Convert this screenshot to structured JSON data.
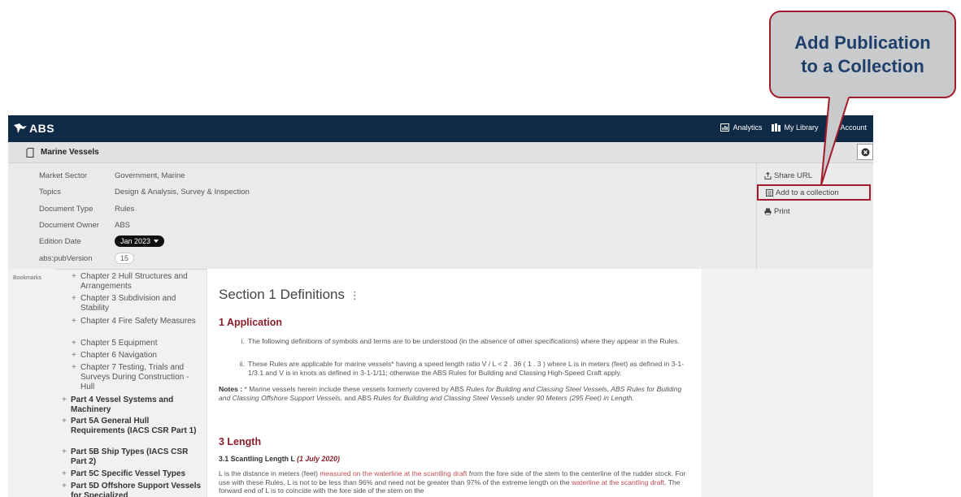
{
  "callout": {
    "text": "Add Publication\nto a Collection"
  },
  "header": {
    "logo": "ABS",
    "nav": [
      {
        "label": "Analytics",
        "icon": "bar-chart-icon"
      },
      {
        "label": "My Library",
        "icon": "library-icon"
      },
      {
        "label": "Account",
        "icon": "user-icon"
      }
    ]
  },
  "document": {
    "title": "Marine Vessels",
    "meta": [
      {
        "label": "Market Sector",
        "value": "Government, Marine"
      },
      {
        "label": "Topics",
        "value": "Design & Analysis, Survey & Inspection"
      },
      {
        "label": "Document Type",
        "value": "Rules"
      },
      {
        "label": "Document Owner",
        "value": "ABS"
      },
      {
        "label": "Edition Date",
        "value": "Jan 2023"
      },
      {
        "label": "abs:pubVersion",
        "value": "15"
      }
    ],
    "actions": [
      {
        "label": "Share URL",
        "icon": "share-icon"
      },
      {
        "label": "Add to a collection",
        "icon": "collection-icon"
      },
      {
        "label": "Print",
        "icon": "print-icon"
      }
    ]
  },
  "sidebar": {
    "rail_label": "Bookmarks",
    "toc": [
      "Chapter 2 Hull Structures and Arrangements",
      "Chapter 3 Subdivision and Stability",
      "Chapter 4 Fire Safety Measures",
      "Chapter 5 Equipment",
      "Chapter 6 Navigation",
      "Chapter 7 Testing, Trials and Surveys During Construction - Hull",
      "Part 4 Vessel Systems and Machinery",
      "Part 5A General Hull Requirements (IACS CSR Part 1)",
      "Part 5B Ship Types (IACS CSR Part 2)",
      "Part 5C Specific Vessel Types",
      "Part 5D Offshore Support Vessels for Specialized"
    ]
  },
  "content": {
    "section_title": "Section 1 Definitions",
    "section_menu": "⋮",
    "application_heading": "1 Application",
    "items": [
      {
        "num": "i.",
        "text": "The following definitions of symbols and terms are to be understood (in the absence of other specifications) where they appear in the Rules."
      },
      {
        "num": "ii.",
        "text": "These Rules are applicable for marine vessels* having a speed length ratio V / L < 2 . 36 ( 1 . 3 ) where L is in meters (feet) as defined in 3-1-1/3.1 and V is in knots as defined in 3-1-1/11; otherwise the ABS Rules for Building and Classing High-Speed Craft apply."
      }
    ],
    "notes_label": "Notes :",
    "notes_pre": " * Marine vessels herein include these vessels formerly covered by ABS ",
    "notes_italic1": "Rules for Building and Classing Steel Vessels, ABS Rules for Building and Classing Offshore Support Vessels,",
    "notes_mid": " and ABS ",
    "notes_italic2": "Rules for Building and Classing Steel Vessels under 90 Meters (295 Feet) in Length.",
    "length_heading": "3 Length",
    "subheading": "3.1 Scantling Length L",
    "subheading_date": "(1 July 2020)",
    "para_1": "L is the distance in meters (feet) ",
    "para_red1": "measured on the waterline at the scantling draft",
    "para_2": " from the fore side of the stem to the centerline of the rudder stock. For use with these Rules, L is not to be less than 96% and need not be greater than 97% of the extreme length on the ",
    "para_red2": "waterline at the scantling draft",
    "para_3": ". The forward end of L is to coincide with the fore side of the stem on the"
  },
  "colors": {
    "navbar": "#0f2a47",
    "accent_red": "#8b1e2b",
    "highlight_border": "#a31b2a",
    "callout_bg": "#c9cacc",
    "callout_text": "#1f3f6b"
  }
}
